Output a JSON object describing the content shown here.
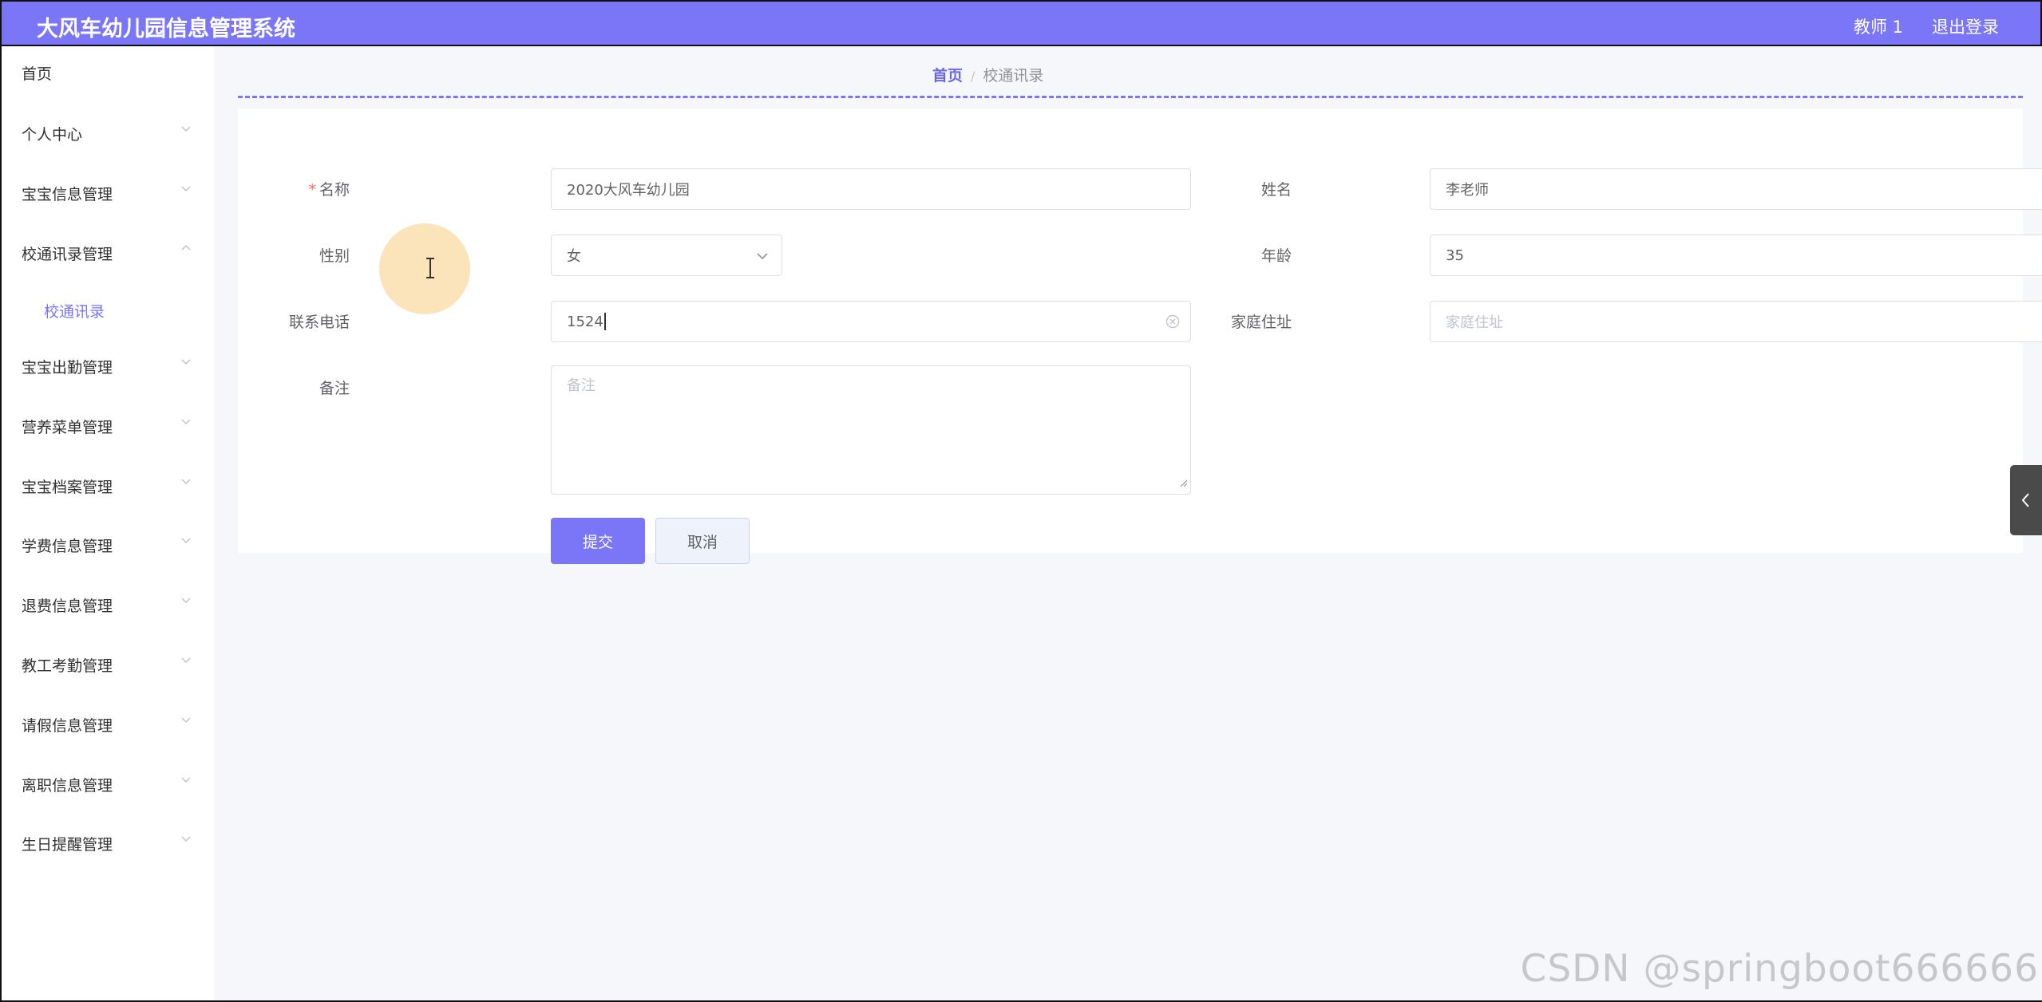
{
  "header": {
    "app_title": "大风车幼儿园信息管理系统",
    "user": "教师 1",
    "logout": "退出登录"
  },
  "sidebar": {
    "items": [
      {
        "label": "首页",
        "expandable": false
      },
      {
        "label": "个人中心",
        "expandable": true
      },
      {
        "label": "宝宝信息管理",
        "expandable": true
      },
      {
        "label": "校通讯录管理",
        "expandable": true,
        "expanded": true
      },
      {
        "label": "校通讯录",
        "submenu": true,
        "active": true
      },
      {
        "label": "宝宝出勤管理",
        "expandable": true
      },
      {
        "label": "营养菜单管理",
        "expandable": true
      },
      {
        "label": "宝宝档案管理",
        "expandable": true
      },
      {
        "label": "学费信息管理",
        "expandable": true
      },
      {
        "label": "退费信息管理",
        "expandable": true
      },
      {
        "label": "教工考勤管理",
        "expandable": true
      },
      {
        "label": "请假信息管理",
        "expandable": true
      },
      {
        "label": "离职信息管理",
        "expandable": true
      },
      {
        "label": "生日提醒管理",
        "expandable": true
      }
    ]
  },
  "breadcrumb": {
    "home": "首页",
    "separator": "/",
    "current": "校通讯录"
  },
  "form": {
    "name": {
      "label": "名称",
      "required_mark": "*",
      "value": "2020大风车幼儿园"
    },
    "person": {
      "label": "姓名",
      "value": "李老师"
    },
    "gender": {
      "label": "性别",
      "value": "女"
    },
    "age": {
      "label": "年龄",
      "value": "35"
    },
    "phone": {
      "label": "联系电话",
      "value": "1524"
    },
    "address": {
      "label": "家庭住址",
      "value": "",
      "placeholder": "家庭住址"
    },
    "remark": {
      "label": "备注",
      "value": "",
      "placeholder": "备注"
    },
    "submit_label": "提交",
    "cancel_label": "取消"
  },
  "watermark": "CSDN @springboot666666",
  "colors": {
    "accent": "#7b76f7",
    "background": "#f5f7fa",
    "side_tab": "#4a4a4a"
  }
}
